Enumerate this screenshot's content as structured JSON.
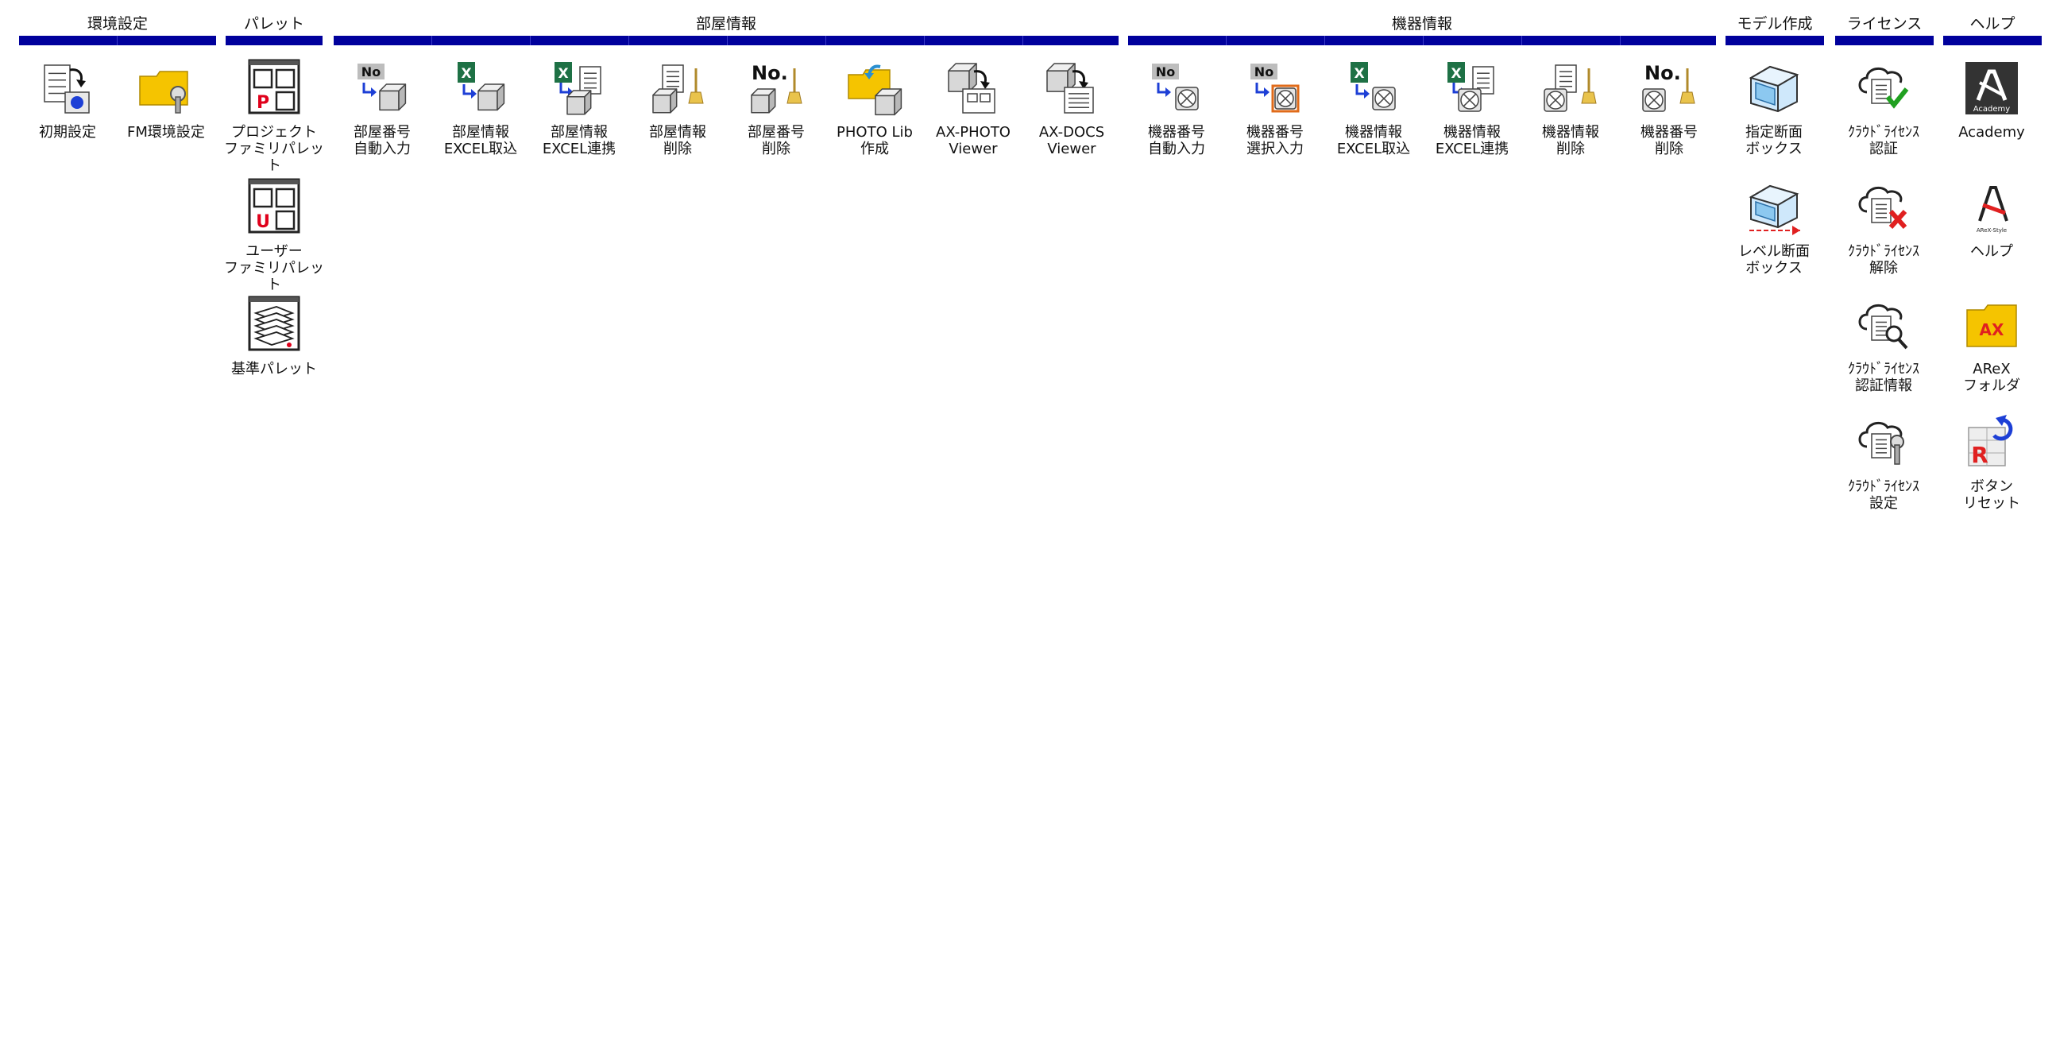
{
  "groups": [
    {
      "title": "環境設定",
      "items": [
        {
          "label": "初期設定",
          "icon": "initial-settings-icon"
        },
        {
          "label": "FM環境設定",
          "icon": "folder-wrench-icon"
        }
      ]
    },
    {
      "title": "パレット",
      "items": [
        {
          "label": "プロジェクト\nファミリパレット",
          "icon": "project-palette-icon",
          "badge": "P"
        },
        {
          "label": "ユーザー\nファミリパレット",
          "icon": "user-palette-icon",
          "badge": "U"
        },
        {
          "label": "基準パレット",
          "icon": "level-palette-icon"
        }
      ]
    },
    {
      "title": "部屋情報",
      "items": [
        {
          "label": "部屋番号\n自動入力",
          "icon": "room-number-auto-icon",
          "badge": "No"
        },
        {
          "label": "部屋情報\nEXCEL取込",
          "icon": "room-excel-import-icon",
          "badge": "X"
        },
        {
          "label": "部屋情報\nEXCEL連携",
          "icon": "room-excel-link-icon",
          "badge": "X"
        },
        {
          "label": "部屋情報\n削除",
          "icon": "room-info-delete-icon"
        },
        {
          "label": "部屋番号\n削除",
          "icon": "room-number-delete-icon",
          "badge": "No."
        },
        {
          "label": "PHOTO Lib\n作成",
          "icon": "photo-lib-create-icon"
        },
        {
          "label": "AX-PHOTO\nViewer",
          "icon": "ax-photo-viewer-icon"
        },
        {
          "label": "AX-DOCS\nViewer",
          "icon": "ax-docs-viewer-icon"
        }
      ]
    },
    {
      "title": "機器情報",
      "items": [
        {
          "label": "機器番号\n自動入力",
          "icon": "equipment-number-auto-icon",
          "badge": "No"
        },
        {
          "label": "機器番号\n選択入力",
          "icon": "equipment-number-select-icon",
          "badge": "No"
        },
        {
          "label": "機器情報\nEXCEL取込",
          "icon": "equipment-excel-import-icon",
          "badge": "X"
        },
        {
          "label": "機器情報\nEXCEL連携",
          "icon": "equipment-excel-link-icon",
          "badge": "X"
        },
        {
          "label": "機器情報\n削除",
          "icon": "equipment-info-delete-icon"
        },
        {
          "label": "機器番号\n削除",
          "icon": "equipment-number-delete-icon",
          "badge": "No."
        }
      ]
    },
    {
      "title": "モデル作成",
      "items": [
        {
          "label": "指定断面\nボックス",
          "icon": "section-box-icon"
        },
        {
          "label": "レベル断面\nボックス",
          "icon": "level-section-box-icon"
        }
      ]
    },
    {
      "title": "ライセンス",
      "items": [
        {
          "label": "ｸﾗｳﾄﾞﾗｲｾﾝｽ\n認証",
          "icon": "cloud-license-auth-icon"
        },
        {
          "label": "ｸﾗｳﾄﾞﾗｲｾﾝｽ\n解除",
          "icon": "cloud-license-release-icon"
        },
        {
          "label": "ｸﾗｳﾄﾞﾗｲｾﾝｽ\n認証情報",
          "icon": "cloud-license-info-icon"
        },
        {
          "label": "ｸﾗｳﾄﾞﾗｲｾﾝｽ\n設定",
          "icon": "cloud-license-settings-icon"
        }
      ]
    },
    {
      "title": "ヘルプ",
      "items": [
        {
          "label": "Academy",
          "icon": "academy-icon",
          "badge": "Academy"
        },
        {
          "label": "ヘルプ",
          "icon": "help-icon",
          "badge": "AReX-Style"
        },
        {
          "label": "AReX\nフォルダ",
          "icon": "arex-folder-icon",
          "badge": "AX"
        },
        {
          "label": "ボタン\nリセット",
          "icon": "button-reset-icon",
          "badge": "R"
        }
      ]
    }
  ],
  "colors": {
    "bar": "#00009c",
    "excel_green": "#1e7145",
    "arrow_blue": "#1d3fd6",
    "folder_yellow": "#f5c400",
    "check_green": "#20a020",
    "cross_red": "#e02020",
    "badge_red": "#e0001b"
  }
}
